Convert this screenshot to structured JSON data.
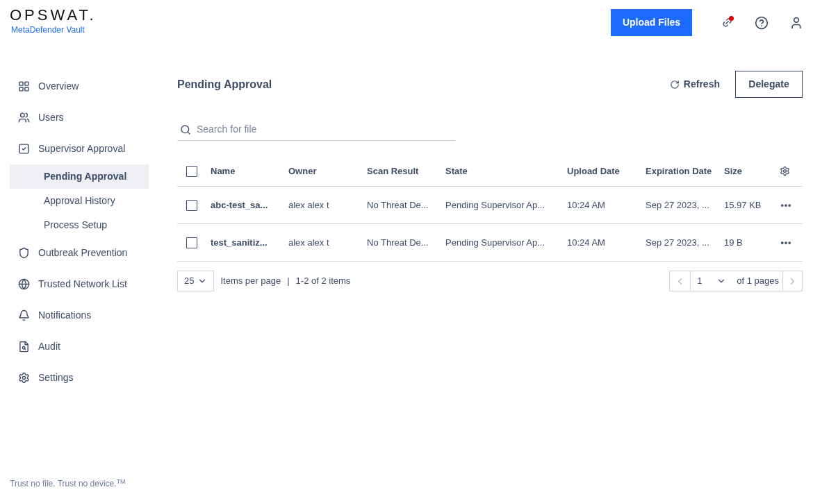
{
  "header": {
    "logo": "OPSWAT.",
    "product": "MetaDefender Vault",
    "upload_button": "Upload Files",
    "notification_dot": true
  },
  "sidebar": {
    "items": [
      {
        "label": "Overview",
        "selected": false
      },
      {
        "label": "Users",
        "selected": false
      },
      {
        "label": "Supervisor Approval",
        "selected": false,
        "children": [
          {
            "label": "Pending Approval",
            "selected": true
          },
          {
            "label": "Approval History",
            "selected": false
          },
          {
            "label": "Process Setup",
            "selected": false
          }
        ]
      },
      {
        "label": "Outbreak Prevention",
        "selected": false
      },
      {
        "label": "Trusted Network List",
        "selected": false
      },
      {
        "label": "Notifications",
        "selected": false
      },
      {
        "label": "Audit",
        "selected": false
      },
      {
        "label": "Settings",
        "selected": false
      }
    ]
  },
  "footer": "Trust no file. Trust no device.$^{TM}$",
  "page": {
    "title": "Pending Approval",
    "refresh": "Refresh",
    "delegate": "Delegate",
    "search": {
      "placeholder": "Search for file"
    }
  },
  "table": {
    "all_checked": false,
    "columns": [
      "Name",
      "Owner",
      "Scan Result",
      "State",
      "Upload Date",
      "Expiration Date",
      "Size"
    ],
    "rows": [
      {
        "checked": false,
        "cells": [
          "abc-test_sa...",
          "alex alex t",
          "No Threat De...",
          "Pending Supervisor Ap...",
          "10:24 AM",
          "Sep 27 2023, ...",
          "15.97 KB"
        ]
      },
      {
        "checked": false,
        "cells": [
          "test_sanitiz...",
          "alex alex t",
          "No Threat De...",
          "Pending Supervisor Ap...",
          "10:24 AM",
          "Sep 27 2023, ...",
          "19 B"
        ]
      }
    ]
  },
  "pagination": {
    "page_size": "25",
    "items_per_page": "Items per page",
    "separator": "|",
    "range": "1-2 of 2 items",
    "page": "1",
    "of_pages": "of 1 pages"
  }
}
